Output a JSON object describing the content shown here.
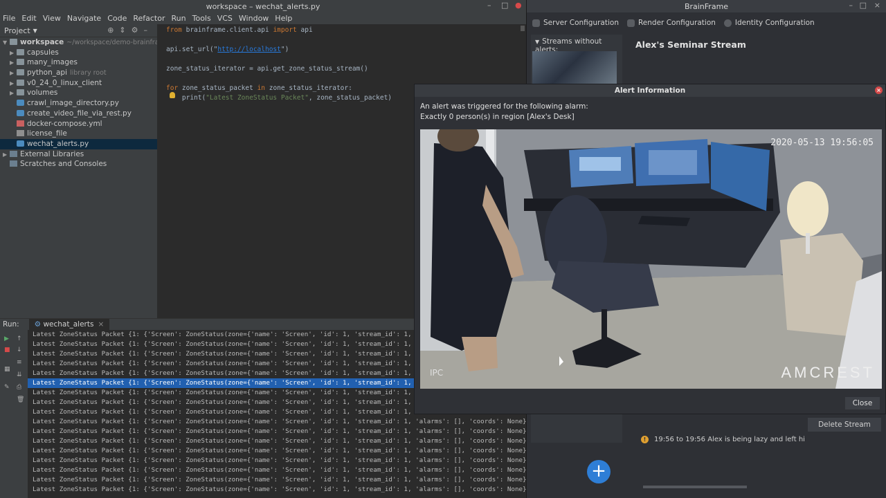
{
  "ide": {
    "title": "workspace – wechat_alerts.py",
    "menu": [
      "File",
      "Edit",
      "View",
      "Navigate",
      "Code",
      "Refactor",
      "Run",
      "Tools",
      "VCS",
      "Window",
      "Help"
    ],
    "project_label": "Project",
    "tree": {
      "root_name": "workspace",
      "root_path": "~/workspace/demo-brainframe-",
      "capsules": "capsules",
      "many_images": "many_images",
      "python_api": "python_api",
      "python_api_hint": "library root",
      "v0_client": "v0_24_0_linux_client",
      "volumes": "volumes",
      "crawl": "crawl_image_directory.py",
      "create_video": "create_video_file_via_rest.py",
      "docker": "docker-compose.yml",
      "license": "license_file",
      "wechat": "wechat_alerts.py",
      "external": "External Libraries",
      "scratches": "Scratches and Consoles"
    },
    "code": {
      "l1_kw1": "from",
      "l1_mod": " brainframe.client.api ",
      "l1_kw2": "import",
      "l1_name": " api",
      "l2_pre": "api.set_url(\"",
      "l2_url": "http://localhost",
      "l2_post": "\")",
      "l3": "zone_status_iterator = api.get_zone_status_stream()",
      "l4_kw1": "for",
      "l4_mid": " zone_status_packet ",
      "l4_kw2": "in",
      "l4_post": " zone_status_iterator:",
      "l5_pre": "    print(",
      "l5_str": "\"Latest ZoneStatus Packet\"",
      "l5_post": ", zone_status_packet)"
    },
    "run": {
      "label": "Run:",
      "tab": "wechat_alerts",
      "lines": [
        "Latest ZoneStatus Packet {1: {'Screen': ZoneStatus(zone={'name': 'Screen', 'id': 1, 'stream_id': 1, 'al",
        "Latest ZoneStatus Packet {1: {'Screen': ZoneStatus(zone={'name': 'Screen', 'id': 1, 'stream_id': 1, 'al",
        "Latest ZoneStatus Packet {1: {'Screen': ZoneStatus(zone={'name': 'Screen', 'id': 1, 'stream_id': 1, 'al",
        "Latest ZoneStatus Packet {1: {'Screen': ZoneStatus(zone={'name': 'Screen', 'id': 1, 'stream_id': 1, 'al",
        "Latest ZoneStatus Packet {1: {'Screen': ZoneStatus(zone={'name': 'Screen', 'id': 1, 'stream_id': 1, 'al",
        "Latest ZoneStatus Packet {1: {'Screen': ZoneStatus(zone={'name': 'Screen', 'id': 1, 'stream_id': 1, 'al",
        "Latest ZoneStatus Packet {1: {'Screen': ZoneStatus(zone={'name': 'Screen', 'id': 1, 'stream_id': 1, 'al",
        "Latest ZoneStatus Packet {1: {'Screen': ZoneStatus(zone={'name': 'Screen', 'id': 1, 'stream_id': 1, 'al",
        "Latest ZoneStatus Packet {1: {'Screen': ZoneStatus(zone={'name': 'Screen', 'id': 1, 'stream_id': 1, 'al",
        "Latest ZoneStatus Packet {1: {'Screen': ZoneStatus(zone={'name': 'Screen', 'id': 1, 'stream_id': 1, 'alarms': [], 'coords': None}, tst",
        "Latest ZoneStatus Packet {1: {'Screen': ZoneStatus(zone={'name': 'Screen', 'id': 1, 'stream_id': 1, 'alarms': [], 'coords': None}, tst",
        "Latest ZoneStatus Packet {1: {'Screen': ZoneStatus(zone={'name': 'Screen', 'id': 1, 'stream_id': 1, 'alarms': [], 'coords': None}, tst",
        "Latest ZoneStatus Packet {1: {'Screen': ZoneStatus(zone={'name': 'Screen', 'id': 1, 'stream_id': 1, 'alarms': [], 'coords': None}, tst",
        "Latest ZoneStatus Packet {1: {'Screen': ZoneStatus(zone={'name': 'Screen', 'id': 1, 'stream_id': 1, 'alarms': [], 'coords': None}, tst",
        "Latest ZoneStatus Packet {1: {'Screen': ZoneStatus(zone={'name': 'Screen', 'id': 1, 'stream_id': 1, 'alarms': [], 'coords': None}, tst",
        "Latest ZoneStatus Packet {1: {'Screen': ZoneStatus(zone={'name': 'Screen', 'id': 1, 'stream_id': 1, 'alarms': [], 'coords': None}, tst",
        "Latest ZoneStatus Packet {1: {'Screen': ZoneStatus(zone={'name': 'Screen', 'id': 1, 'stream_id': 1, 'alarms': [], 'coords': None}, tst"
      ],
      "highlighted_index": 5
    }
  },
  "brainframe": {
    "title": "BrainFrame",
    "toolbar": {
      "server": "Server Configuration",
      "render": "Render Configuration",
      "identity": "Identity Configuration"
    },
    "streams_without_alerts": "Streams without alerts:",
    "stream_title": "Alex's Seminar Stream",
    "delete_stream": "Delete Stream",
    "alert_entry": "19:56 to 19:56  Alex is being lazy and left hi",
    "warn_glyph": "!",
    "plus_glyph": "+"
  },
  "alert_dialog": {
    "title": "Alert Information",
    "line1": "An alert was triggered for the following alarm:",
    "line2": "Exactly 0 person(s) in region [Alex's Desk]",
    "timestamp": "2020-05-13 19:56:05",
    "ipc": "IPC",
    "brand": "AMCREST",
    "close": "Close"
  },
  "colors": {
    "accent_blue": "#2e7ed6",
    "selection": "#2160b0",
    "warning": "#e0a030",
    "close_red": "#d64a4a"
  }
}
